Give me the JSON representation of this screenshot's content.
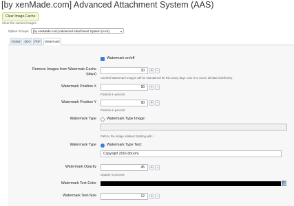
{
  "page": {
    "title": "[by xenMade.com] Advanced Attachment System (AAS)",
    "clear_cache_button": "Clear Image-Cache",
    "clear_cache_description": "Clear the cached images",
    "option_groups_label": "Option Groups:",
    "option_groups_value": "[by xenMade.com] Advanced Attachment System (AAS)"
  },
  "tabs": [
    {
      "label": "Global"
    },
    {
      "label": "SEO"
    },
    {
      "label": "PDF"
    },
    {
      "label": "Watermark",
      "active": true
    }
  ],
  "form": {
    "watermark_onoff": {
      "label": "Watermark on/off",
      "checked": true
    },
    "remove_images": {
      "label_line1": "Remove Images from Watermak-Cache",
      "label_line2": "(days)",
      "value": "30",
      "hint": "Cached Watermark Images will be maintained for this many days. Use 0 to cache all data indefinitely."
    },
    "position_x": {
      "label": "Watermark Position X",
      "value": "90",
      "hint": "Position in percent"
    },
    "position_y": {
      "label": "Watermark Position Y",
      "value": "90",
      "hint": "Position in percent"
    },
    "type_image": {
      "label": "Watermark Type",
      "option": "Watermark Type Image:",
      "selected": false,
      "value": "",
      "hint": "Path to the image relative! Starting with /"
    },
    "type_text": {
      "label": "Watermark Type",
      "option": "Watermark Type Text:",
      "selected": true,
      "value": "Copyright 2016 {forum}"
    },
    "opacity": {
      "label": "Watermark Opacity",
      "value": "45",
      "hint": "Opacity in percent"
    },
    "text_color": {
      "label": "Watermark Text-Color",
      "value": "#000000"
    },
    "text_size": {
      "label": "Watermark Text-Size",
      "value": "12"
    }
  },
  "stepper": {
    "plus": "+",
    "minus": "-"
  },
  "colors": {
    "accent": "#3b7dd8",
    "panel_bg": "#f7f7f7",
    "tab_bg": "#e9eff5"
  }
}
